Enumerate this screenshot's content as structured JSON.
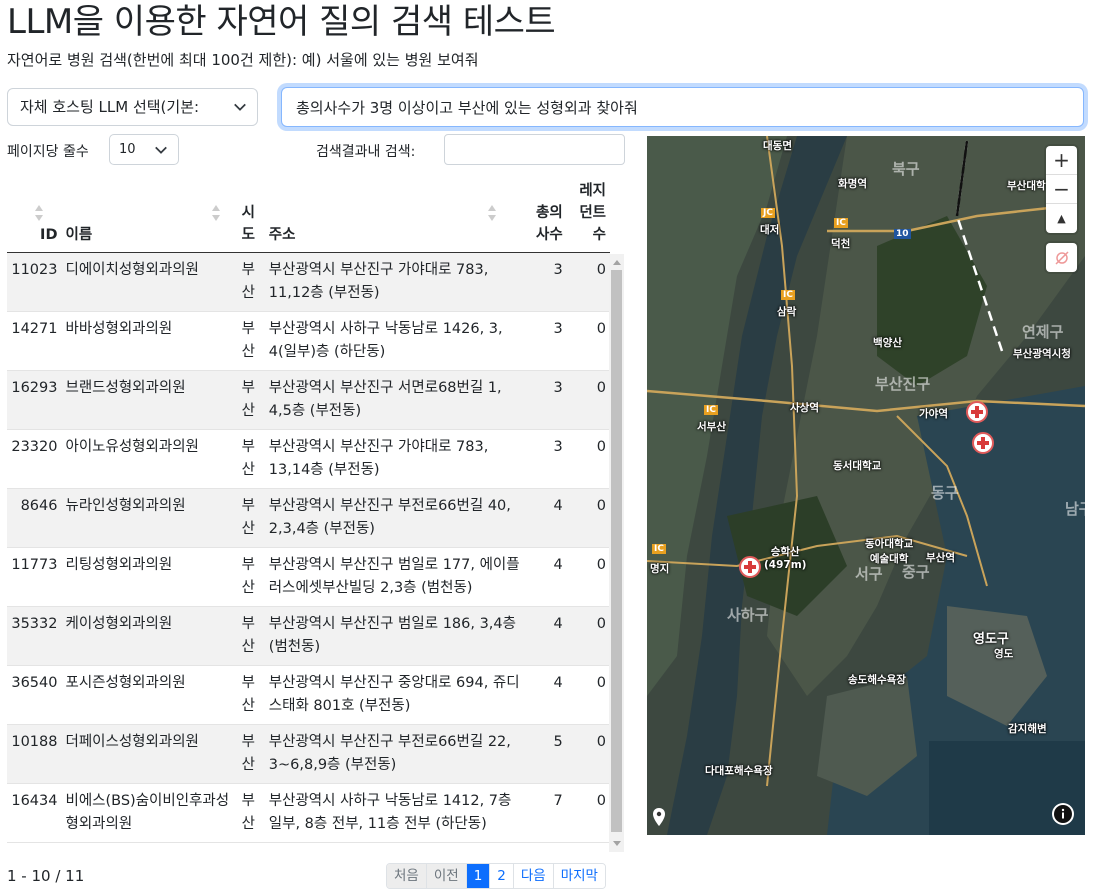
{
  "page": {
    "title": "LLM을 이용한 자연어 질의 검색 테스트",
    "subtitle": "자연어로 병원 검색(한번에 최대 100건 제한): 예) 서울에 있는 병원 보여줘"
  },
  "controls": {
    "llm_select_value": "자체 호스팅 LLM 선택(기본:",
    "query_value": "총의사수가 3명 이상이고 부산에 있는 성형외과 찾아줘",
    "rows_label": "페이지당 줄수",
    "rows_value": "10",
    "search_label": "검색결과내 검색:",
    "search_value": ""
  },
  "table": {
    "headers": {
      "id": "ID",
      "name": "이름",
      "sido": "시도",
      "address": "주소",
      "doctors": "총의사수",
      "residents": "레지던트수"
    },
    "rows": [
      {
        "id": "11023",
        "name": "디에이치성형외과의원",
        "sido": "부산",
        "address": "부산광역시 부산진구 가야대로 783, 11,12층 (부전동)",
        "doctors": "3",
        "residents": "0"
      },
      {
        "id": "14271",
        "name": "바바성형외과의원",
        "sido": "부산",
        "address": "부산광역시 사하구 낙동남로 1426, 3, 4(일부)층 (하단동)",
        "doctors": "3",
        "residents": "0"
      },
      {
        "id": "16293",
        "name": "브랜드성형외과의원",
        "sido": "부산",
        "address": "부산광역시 부산진구 서면로68번길 1, 4,5층 (부전동)",
        "doctors": "3",
        "residents": "0"
      },
      {
        "id": "23320",
        "name": "아이노유성형외과의원",
        "sido": "부산",
        "address": "부산광역시 부산진구 가야대로 783, 13,14층 (부전동)",
        "doctors": "3",
        "residents": "0"
      },
      {
        "id": "8646",
        "name": "뉴라인성형외과의원",
        "sido": "부산",
        "address": "부산광역시 부산진구 부전로66번길 40, 2,3,4층 (부전동)",
        "doctors": "4",
        "residents": "0"
      },
      {
        "id": "11773",
        "name": "리팅성형외과의원",
        "sido": "부산",
        "address": "부산광역시 부산진구 범일로 177, 에이플러스에셋부산빌딩 2,3층 (범천동)",
        "doctors": "4",
        "residents": "0"
      },
      {
        "id": "35332",
        "name": "케이성형외과의원",
        "sido": "부산",
        "address": "부산광역시 부산진구 범일로 186, 3,4층 (범천동)",
        "doctors": "4",
        "residents": "0"
      },
      {
        "id": "36540",
        "name": "포시즌성형외과의원",
        "sido": "부산",
        "address": "부산광역시 부산진구 중앙대로 694, 쥬디스태화 801호 (부전동)",
        "doctors": "4",
        "residents": "0"
      },
      {
        "id": "10188",
        "name": "더페이스성형외과의원",
        "sido": "부산",
        "address": "부산광역시 부산진구 부전로66번길 22, 3~6,8,9층 (부전동)",
        "doctors": "5",
        "residents": "0"
      },
      {
        "id": "16434",
        "name": "비에스(BS)숨이비인후과성형외과의원",
        "sido": "부산",
        "address": "부산광역시 사하구 낙동남로 1412, 7층 일부, 8층 전부, 11층 전부 (하단동)",
        "doctors": "7",
        "residents": "0"
      }
    ]
  },
  "pagination": {
    "info": "1 - 10 / 11",
    "first": "처음",
    "prev": "이전",
    "page1": "1",
    "page2": "2",
    "next": "다음",
    "last": "마지막"
  },
  "map": {
    "labels": {
      "l1": "대동면",
      "l2": "북구",
      "l3": "화명역",
      "l4": "부산대학",
      "l5": "대저",
      "l6": "덕천",
      "l7": "10",
      "l8": "삼락",
      "l9": "백양산",
      "l10": "연제구",
      "l11": "부산광역시청",
      "l12": "부산진구",
      "l13": "사상역",
      "l14": "서부산",
      "l15": "가야역",
      "l16": "동서대학교",
      "l17": "동구",
      "l18": "승학산\n(497m)",
      "l19": "동아대학교\n예술대학",
      "l20": "부산역",
      "l21": "명지",
      "l22": "서구",
      "l23": "사하구",
      "l24": "영도구",
      "l25": "영도",
      "l26": "송도해수욕장",
      "l27": "감지해변",
      "l28": "다대포해수욕장",
      "l29": "남구",
      "l30": "중구",
      "l31": "IC",
      "l32": "IC",
      "l33": "IC",
      "l34": "JC",
      "l35": "IC"
    },
    "zoom_in": "+",
    "zoom_out": "−",
    "reset": "▲",
    "info": "i"
  }
}
